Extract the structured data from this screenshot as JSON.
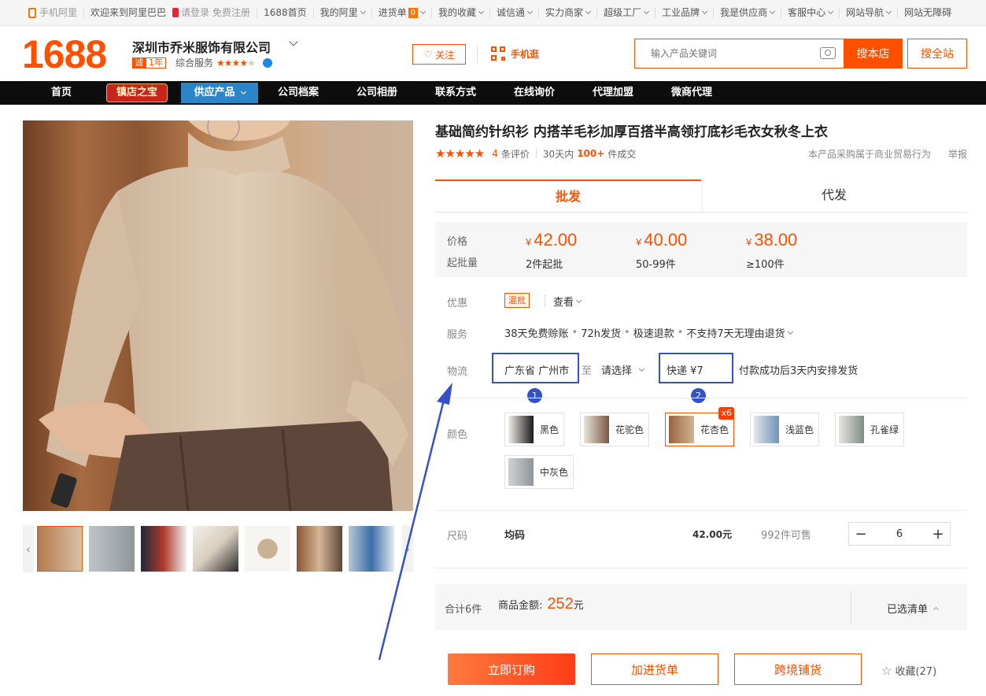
{
  "topbar": {
    "mobile_ali": "手机阿里",
    "welcome": "欢迎来到阿里巴巴",
    "login": "请登录",
    "register": "免费注册",
    "home1688": "1688首页",
    "my_ali": "我的阿里",
    "cart": "进货单",
    "cart_count": "0",
    "favorites": "我的收藏",
    "chengxintong": "诚信通",
    "strength": "实力商家",
    "factory": "超级工厂",
    "brand": "工业品牌",
    "supplier": "我是供应商",
    "service": "客服中心",
    "site_nav": "网站导航",
    "accessible": "网站无障碍"
  },
  "header": {
    "logo": "1688",
    "company": "深圳市乔米服饰有限公司",
    "cheng": "诚",
    "years": "1年",
    "composite": "综合服务",
    "composite_rating": 4,
    "follow": "关注",
    "mobile_shop": "手机逛",
    "search_placeholder": "输入产品关键词",
    "search_store": "搜本店",
    "search_all": "搜全站"
  },
  "nav": {
    "home": "首页",
    "treasure": "镇店之宝",
    "supply": "供应产品",
    "profile": "公司档案",
    "album": "公司相册",
    "contact": "联系方式",
    "inquiry": "在线询价",
    "agent": "代理加盟",
    "micro": "微商代理"
  },
  "product": {
    "title": "基础简约针织衫 内搭羊毛衫加厚百搭半高领打底衫毛衣女秋冬上衣",
    "rating": 5,
    "review_count": "4",
    "review_label": "条评价",
    "deals_prefix": "30天内",
    "deals_count": "100+",
    "deals_suffix": "件成交",
    "trade_note": "本产品采购属于商业贸易行为",
    "report": "举报"
  },
  "tabs": {
    "wholesale": "批发",
    "dropship": "代发"
  },
  "pricing": {
    "price_label": "价格",
    "moq_label": "起批量",
    "currency": "¥",
    "tiers": [
      {
        "price": "42.00",
        "qty": "2件起批"
      },
      {
        "price": "40.00",
        "qty": "50-99件"
      },
      {
        "price": "38.00",
        "qty": "≥100件"
      }
    ]
  },
  "promo": {
    "label": "优惠",
    "tag": "混批",
    "view": "查看"
  },
  "service": {
    "label": "服务",
    "items": [
      "38天免费赊账",
      "72h发货",
      "极速退款",
      "不支持7天无理由退货"
    ]
  },
  "logistics": {
    "label": "物流",
    "from": "广东省 广州市",
    "to_word": "至",
    "destination": "请选择",
    "shipping": "快递 ¥7",
    "note": "付款成功后3天内安排发货",
    "marker1": "1",
    "marker2": "2"
  },
  "colors": {
    "label": "颜色",
    "options": [
      {
        "name": "黑色"
      },
      {
        "name": "花驼色"
      },
      {
        "name": "花杏色",
        "badge": "x6"
      },
      {
        "name": "浅蓝色"
      },
      {
        "name": "孔雀绿"
      },
      {
        "name": "中灰色"
      }
    ]
  },
  "size": {
    "label": "尺码",
    "value": "均码",
    "price": "42.00元",
    "stock": "992件可售",
    "quantity": "6"
  },
  "summary": {
    "total": "合计6件",
    "amount_label": "商品金额:",
    "amount": "252",
    "unit": "元",
    "selected_list": "已选清单"
  },
  "actions": {
    "buy": "立即订购",
    "add_cart": "加进货单",
    "crossborder": "跨境铺货",
    "favorite": "收藏(27)"
  }
}
